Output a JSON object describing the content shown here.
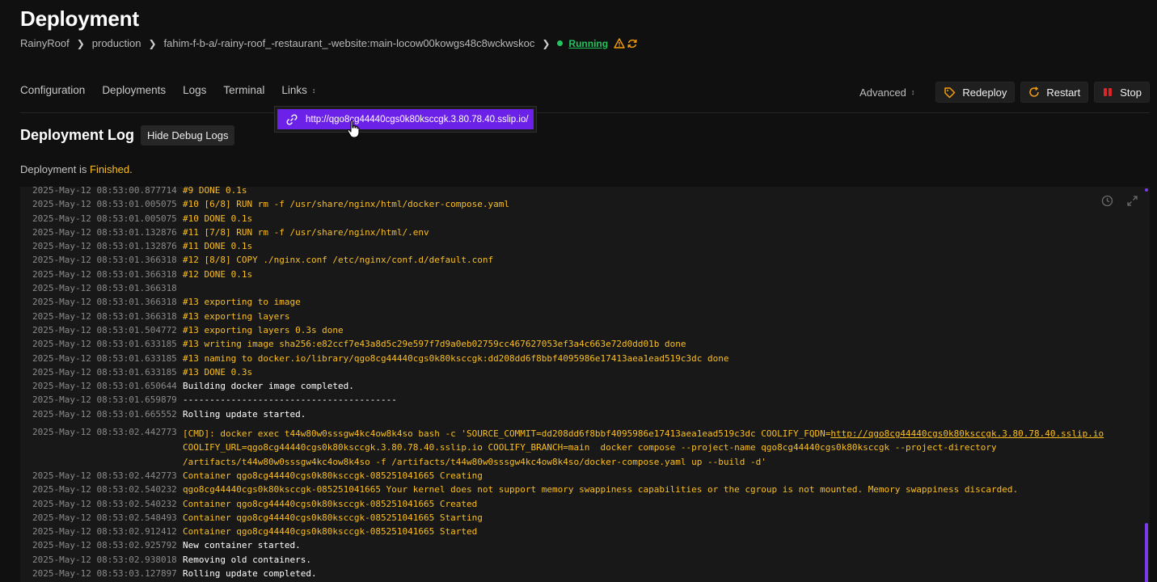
{
  "header": {
    "title": "Deployment",
    "breadcrumb": {
      "project": "RainyRoof",
      "environment": "production",
      "resource": "fahim-f-b-a/-rainy-roof_-restaurant_-website:main-locow00kowgs48c8wckwskoc",
      "status": "Running",
      "status_color": "#22c55e"
    }
  },
  "nav": {
    "tabs": [
      "Configuration",
      "Deployments",
      "Logs",
      "Terminal",
      "Links"
    ],
    "advanced_label": "Advanced",
    "redeploy_label": "Redeploy",
    "restart_label": "Restart",
    "stop_label": "Stop"
  },
  "links_dropdown": {
    "url": "http://qgo8cg44440cgs0k80ksccgk.3.80.78.40.sslip.io/"
  },
  "deployment_log": {
    "title": "Deployment Log",
    "debug_button": "Hide Debug Logs",
    "status_prefix": "Deployment is",
    "status_value": "Finished.",
    "lines": [
      {
        "ts": "2025-May-12 08:53:00.877714",
        "msg": "#9 DONE 0.1s",
        "tone": "warn"
      },
      {
        "ts": "2025-May-12 08:53:01.005075",
        "msg": "#10 [6/8] RUN rm -f /usr/share/nginx/html/docker-compose.yaml",
        "tone": "warn"
      },
      {
        "ts": "2025-May-12 08:53:01.005075",
        "msg": "#10 DONE 0.1s",
        "tone": "warn"
      },
      {
        "ts": "2025-May-12 08:53:01.132876",
        "msg": "#11 [7/8] RUN rm -f /usr/share/nginx/html/.env",
        "tone": "warn"
      },
      {
        "ts": "2025-May-12 08:53:01.132876",
        "msg": "#11 DONE 0.1s",
        "tone": "warn"
      },
      {
        "ts": "2025-May-12 08:53:01.366318",
        "msg": "#12 [8/8] COPY ./nginx.conf /etc/nginx/conf.d/default.conf",
        "tone": "warn"
      },
      {
        "ts": "2025-May-12 08:53:01.366318",
        "msg": "#12 DONE 0.1s",
        "tone": "warn"
      },
      {
        "ts": "2025-May-12 08:53:01.366318",
        "msg": "",
        "tone": "warn"
      },
      {
        "ts": "2025-May-12 08:53:01.366318",
        "msg": "#13 exporting to image",
        "tone": "warn"
      },
      {
        "ts": "2025-May-12 08:53:01.366318",
        "msg": "#13 exporting layers",
        "tone": "warn"
      },
      {
        "ts": "2025-May-12 08:53:01.504772",
        "msg": "#13 exporting layers 0.3s done",
        "tone": "warn"
      },
      {
        "ts": "2025-May-12 08:53:01.633185",
        "msg": "#13 writing image sha256:e82ccf7e43a8d5c29e597f7d9a0eb02759cc467627053ef3a4c663e72d0dd01b done",
        "tone": "warn"
      },
      {
        "ts": "2025-May-12 08:53:01.633185",
        "msg": "#13 naming to docker.io/library/qgo8cg44440cgs0k80ksccgk:dd208dd6f8bbf4095986e17413aea1ead519c3dc done",
        "tone": "warn"
      },
      {
        "ts": "2025-May-12 08:53:01.633185",
        "msg": "#13 DONE 0.3s",
        "tone": "warn"
      },
      {
        "ts": "2025-May-12 08:53:01.650644",
        "msg": "Building docker image completed.",
        "tone": "normal"
      },
      {
        "ts": "2025-May-12 08:53:01.659879",
        "msg": "----------------------------------------",
        "tone": "normal"
      },
      {
        "ts": "2025-May-12 08:53:01.665552",
        "msg": "Rolling update started.",
        "tone": "normal"
      }
    ],
    "cmd_block": {
      "ts": "2025-May-12 08:53:02.442773",
      "line1_prefix": "[CMD]: docker exec t44w80w0sssgw4kc4ow8k4so bash -c 'SOURCE_COMMIT=dd208dd6f8bbf4095986e17413aea1ead519c3dc COOLIFY_FQDN=",
      "line1_url": "http://qgo8cg44440cgs0k80ksccgk.3.80.78.40.sslip.io",
      "line2": "COOLIFY_URL=qgo8cg44440cgs0k80ksccgk.3.80.78.40.sslip.io COOLIFY_BRANCH=main  docker compose --project-name qgo8cg44440cgs0k80ksccgk --project-directory",
      "line3": "/artifacts/t44w80w0sssgw4kc4ow8k4so -f /artifacts/t44w80w0sssgw4kc4ow8k4so/docker-compose.yaml up --build -d'"
    },
    "lines_after": [
      {
        "ts": "2025-May-12 08:53:02.442773",
        "msg": "Container qgo8cg44440cgs0k80ksccgk-085251041665  Creating",
        "tone": "warn"
      },
      {
        "ts": "2025-May-12 08:53:02.540232",
        "msg": "qgo8cg44440cgs0k80ksccgk-085251041665 Your kernel does not support memory swappiness capabilities or the cgroup is not mounted. Memory swappiness discarded.",
        "tone": "warn"
      },
      {
        "ts": "2025-May-12 08:53:02.540232",
        "msg": "Container qgo8cg44440cgs0k80ksccgk-085251041665  Created",
        "tone": "warn"
      },
      {
        "ts": "2025-May-12 08:53:02.548493",
        "msg": "Container qgo8cg44440cgs0k80ksccgk-085251041665  Starting",
        "tone": "warn"
      },
      {
        "ts": "2025-May-12 08:53:02.912412",
        "msg": "Container qgo8cg44440cgs0k80ksccgk-085251041665  Started",
        "tone": "warn"
      },
      {
        "ts": "2025-May-12 08:53:02.925792",
        "msg": "New container started.",
        "tone": "normal"
      },
      {
        "ts": "2025-May-12 08:53:02.938018",
        "msg": "Removing old containers.",
        "tone": "normal"
      },
      {
        "ts": "2025-May-12 08:53:03.127897",
        "msg": "Rolling update completed.",
        "tone": "normal"
      }
    ]
  },
  "colors": {
    "accent": "#6b21e8",
    "warn_text": "#fbbf24",
    "stop_icon": "#dc2626",
    "redeploy_icon": "#f59e0b"
  }
}
